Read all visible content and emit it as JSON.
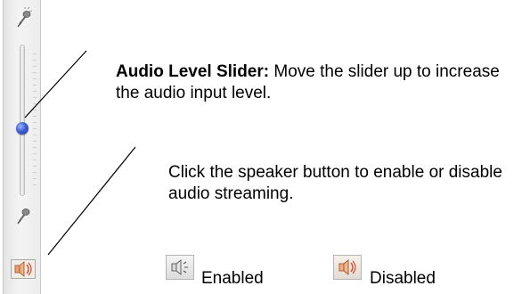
{
  "slider": {
    "level_fraction": 0.45,
    "accent_color": "#3d5fd6"
  },
  "annotations": {
    "slider_title": "Audio Level Slider:",
    "slider_text": " Move the slider up to increase the audio input level.",
    "speaker_text": "Click the speaker button to enable or disable audio streaming."
  },
  "icons": {
    "top": "microphone-icon",
    "bottom": "microphone-icon",
    "speaker": "speaker-icon"
  },
  "legend": {
    "enabled_label": "Enabled",
    "disabled_label": "Disabled"
  }
}
